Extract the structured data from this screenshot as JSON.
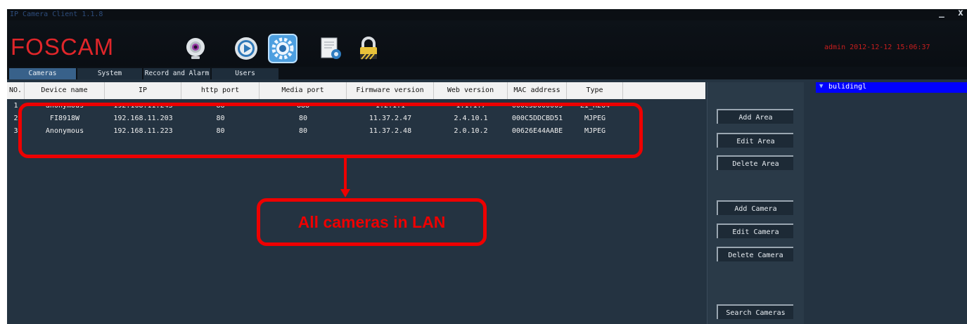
{
  "window": {
    "title": "IP Camera Client 1.1.8",
    "minimize_label": "_",
    "close_label": "x"
  },
  "header": {
    "logo": "FOSCAM",
    "icons": [
      "webcam-icon",
      "play-icon",
      "settings-gear-icon",
      "document-settings-icon",
      "padlock-icon"
    ],
    "user_info": "admin 2012-12-12 15:06:37"
  },
  "tabs": [
    {
      "label": "Cameras",
      "active": true
    },
    {
      "label": "System",
      "active": false
    },
    {
      "label": "Record and Alarm",
      "active": false
    },
    {
      "label": "Users",
      "active": false
    }
  ],
  "table": {
    "columns": [
      "NO.",
      "Device name",
      "IP",
      "http port",
      "Media port",
      "Firmware version",
      "Web version",
      "MAC address",
      "Type"
    ],
    "rows": [
      [
        "1",
        "anonymous",
        "192.168.11.243",
        "88",
        "888",
        "1.2.1.1",
        "1.1.1.7",
        "000C5D000003",
        "ZI_H264"
      ],
      [
        "2",
        "FI8918W",
        "192.168.11.203",
        "80",
        "80",
        "11.37.2.47",
        "2.4.10.1",
        "000C5DDCBD51",
        "MJPEG"
      ],
      [
        "3",
        "Anonymous",
        "192.168.11.223",
        "80",
        "80",
        "11.37.2.48",
        "2.0.10.2",
        "00626E44AABE",
        "MJPEG"
      ]
    ]
  },
  "annotation": {
    "callout": "All cameras in LAN",
    "color": "#ee0000"
  },
  "side_buttons": {
    "add_area": "Add Area",
    "edit_area": "Edit Area",
    "delete_area": "Delete Area",
    "add_camera": "Add Camera",
    "edit_camera": "Edit Camera",
    "delete_camera": "Delete Camera",
    "search_cameras": "Search Cameras"
  },
  "tree": {
    "selected_item": "bulidingl"
  },
  "colors": {
    "background": "#243341",
    "accent_tab": "#38618a",
    "logo": "#e0262a",
    "tree_selection": "#0000ff"
  }
}
